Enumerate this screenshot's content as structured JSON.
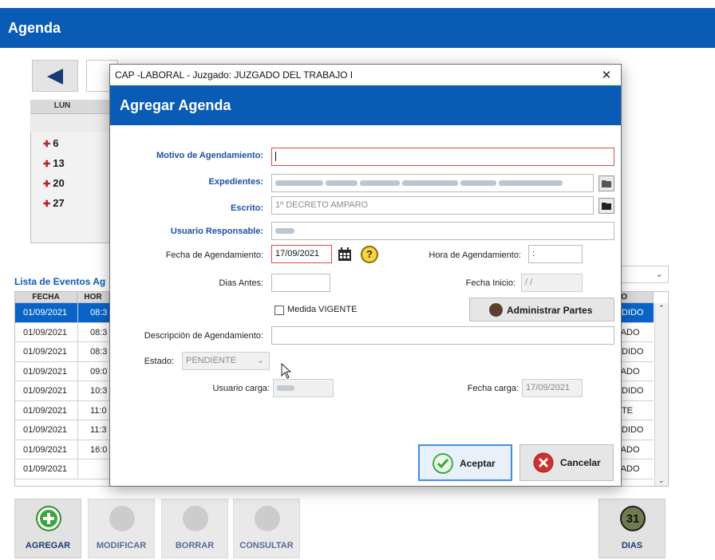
{
  "app": {
    "title": "Agenda"
  },
  "calendar": {
    "header_day": "LUN",
    "days": [
      "6",
      "13",
      "20",
      "27"
    ]
  },
  "events": {
    "title": "Lista de Eventos Ag",
    "columns": [
      "FECHA",
      "HOR",
      "DO"
    ],
    "rows": [
      {
        "fecha": "01/09/2021",
        "hora": "08:3",
        "estado": "NDIDO",
        "selected": true
      },
      {
        "fecha": "01/09/2021",
        "hora": "08:3",
        "estado": "ZADO"
      },
      {
        "fecha": "01/09/2021",
        "hora": "08:3",
        "estado": "NDIDO"
      },
      {
        "fecha": "01/09/2021",
        "hora": "09:0",
        "estado": "ZADO"
      },
      {
        "fecha": "01/09/2021",
        "hora": "10:3",
        "estado": "NDIDO"
      },
      {
        "fecha": "01/09/2021",
        "hora": "11:0",
        "estado": "NTE"
      },
      {
        "fecha": "01/09/2021",
        "hora": "11:3",
        "estado": "NDIDO"
      },
      {
        "fecha": "01/09/2021",
        "hora": "16:0",
        "estado": "ZADO"
      },
      {
        "fecha": "01/09/2021",
        "hora": "",
        "estado": "ZADO"
      }
    ]
  },
  "toolbar": {
    "agregar": "AGREGAR",
    "modificar": "MODIFICAR",
    "borrar": "BORRAR",
    "consultar": "CONSULTAR",
    "dias": "DIAS",
    "dias_icon_num": "31"
  },
  "dialog": {
    "window_title": "CAP -LABORAL - Juzgado: JUZGADO DEL TRABAJO I",
    "close_glyph": "✕",
    "header": "Agregar Agenda",
    "motivo_label": "Motivo de Agendamiento:",
    "motivo_value": "",
    "expedientes_label": "Expedientes:",
    "escrito_label": "Escrito:",
    "escrito_value": "1º DECRETO AMPARO",
    "usuario_label": "Usuario Responsable:",
    "fecha_label": "Fecha de Agendamiento:",
    "fecha_value": "17/09/2021",
    "hora_label": "Hora de Agendamiento:",
    "hora_value": " :",
    "dias_label": "Dias Antes:",
    "dias_value": "",
    "fecha_inicio_label": "Fecha Inicio:",
    "fecha_inicio_value": " / /",
    "medida_label": "Medida VIGENTE",
    "medida_checked": false,
    "admin_button": "Administrar Partes",
    "descripcion_label": "Descripción de Agendamiento:",
    "descripcion_value": "",
    "estado_label": "Estado:",
    "estado_value": "PENDIENTE",
    "usuario_carga_label": "Usuario carga:",
    "fecha_carga_label": "Fecha carga:",
    "fecha_carga_value": "17/09/2021",
    "accept_button": "Aceptar",
    "cancel_button": "Cancelar"
  },
  "colors": {
    "brand_blue": "#0a5bb5",
    "accept_green": "#3aa63a",
    "cancel_red": "#d32f2f"
  }
}
